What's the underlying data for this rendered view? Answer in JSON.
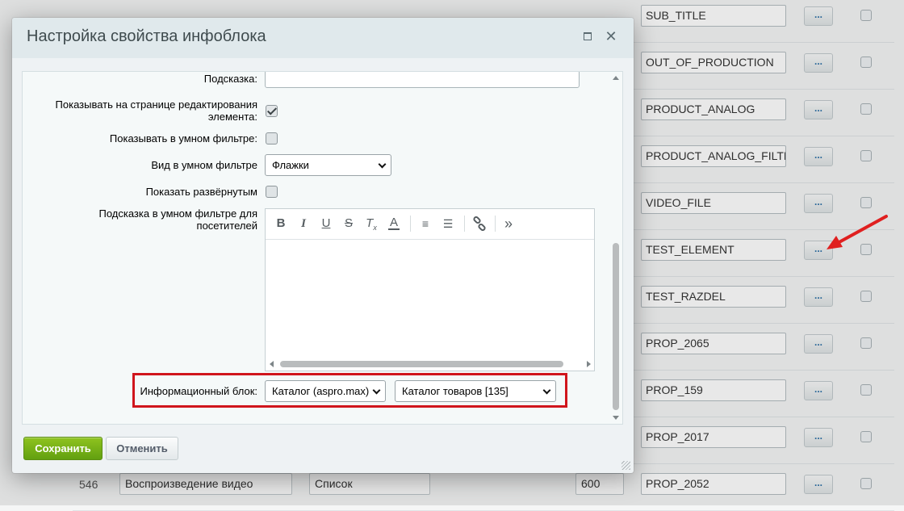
{
  "background": {
    "rows": [
      {
        "code": "SUB_TITLE",
        "dots": "...",
        "num": "",
        "name": "",
        "type": "",
        "sort": ""
      },
      {
        "code": "OUT_OF_PRODUCTION",
        "dots": "...",
        "num": "",
        "name": "",
        "type": "",
        "sort": ""
      },
      {
        "code": "PRODUCT_ANALOG",
        "dots": "...",
        "num": "",
        "name": "",
        "type": "",
        "sort": ""
      },
      {
        "code": "PRODUCT_ANALOG_FILTE",
        "dots": "...",
        "num": "",
        "name": "",
        "type": "",
        "sort": ""
      },
      {
        "code": "VIDEO_FILE",
        "dots": "...",
        "num": "",
        "name": "",
        "type": "",
        "sort": ""
      },
      {
        "code": "TEST_ELEMENT",
        "dots": "...",
        "num": "",
        "name": "",
        "type": "",
        "sort": ""
      },
      {
        "code": "TEST_RAZDEL",
        "dots": "...",
        "num": "",
        "name": "",
        "type": "",
        "sort": ""
      },
      {
        "code": "PROP_2065",
        "dots": "...",
        "num": "",
        "name": "",
        "type": "",
        "sort": ""
      },
      {
        "code": "PROP_159",
        "dots": "...",
        "num": "",
        "name": "",
        "type": "",
        "sort": ""
      },
      {
        "code": "PROP_2017",
        "dots": "...",
        "num": "",
        "name": "",
        "type": "",
        "sort": ""
      },
      {
        "code": "PROP_2052",
        "dots": "...",
        "num": "546",
        "name": "Воспроизведение видео",
        "type": "Список",
        "sort": "600"
      }
    ],
    "arrow_color": "#e02020"
  },
  "dialog": {
    "title": "Настройка свойства инфоблока",
    "fields": {
      "hint_label": "Подсказка:",
      "show_on_edit_label": "Показывать на странице редактирования элемента:",
      "show_on_edit_checked": true,
      "show_in_filter_label": "Показывать в умном фильтре:",
      "show_in_filter_checked": false,
      "filter_view_label": "Вид в умном фильтре",
      "filter_view_value": "Флажки",
      "show_expanded_label": "Показать развёрнутым",
      "show_expanded_checked": false,
      "filter_hint_label": "Подсказка в умном фильтре для посетителей",
      "iblock_label": "Информационный блок:",
      "iblock_type_value": "Каталог (aspro.max)",
      "iblock_value": "Каталог товаров [135]"
    },
    "editor_toolbar": [
      "bold-icon",
      "italic-icon",
      "underline-icon",
      "strikethrough-icon",
      "remove-format-icon",
      "font-color-icon",
      "ordered-list-icon",
      "unordered-list-icon",
      "link-icon",
      "more-icon"
    ],
    "buttons": {
      "save": "Сохранить",
      "cancel": "Отменить"
    },
    "colors": {
      "save_button": "#6cab14",
      "highlight_border": "#d0151c",
      "header_bg": "#e0e9ec"
    }
  }
}
